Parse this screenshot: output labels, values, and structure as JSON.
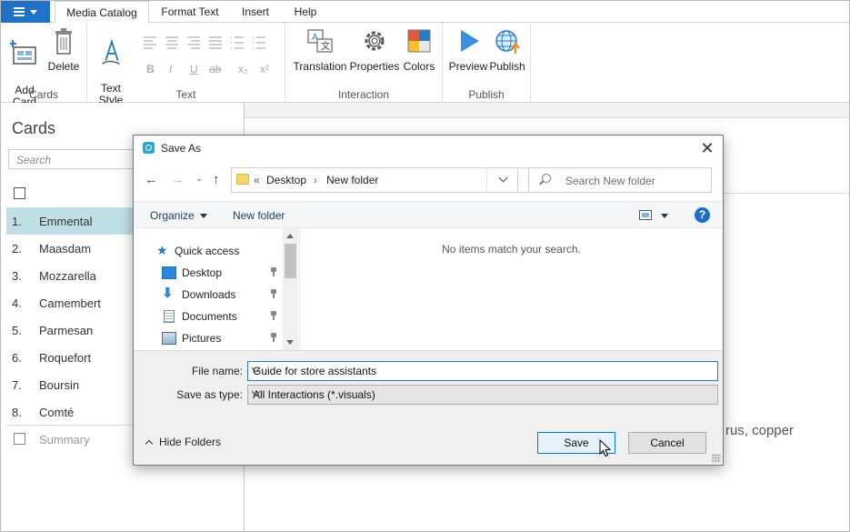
{
  "ribbon": {
    "tabs": [
      {
        "label": "Media Catalog",
        "active": true
      },
      {
        "label": "Format Text",
        "active": false
      },
      {
        "label": "Insert",
        "active": false
      },
      {
        "label": "Help",
        "active": false
      }
    ],
    "groups": {
      "cards": {
        "label": "Cards",
        "add_label": "Add\nCard",
        "delete_label": "Delete"
      },
      "text": {
        "label": "Text",
        "text_style_label": "Text\nStyle"
      },
      "interaction": {
        "label": "Interaction",
        "translation_label": "Translation",
        "properties_label": "Properties",
        "colors_label": "Colors"
      },
      "publish": {
        "label": "Publish",
        "preview_label": "Preview",
        "publish_label": "Publish"
      }
    },
    "format_glyphs": {
      "bold": "B",
      "italic": "I",
      "underline": "U",
      "strike": "ab",
      "subscript": "x₂",
      "superscript": "x²"
    }
  },
  "left_panel": {
    "title": "Cards",
    "search_placeholder": "Search",
    "cards": [
      {
        "num": "1.",
        "name": "Emmental",
        "selected": true
      },
      {
        "num": "2.",
        "name": "Maasdam",
        "selected": false
      },
      {
        "num": "3.",
        "name": "Mozzarella",
        "selected": false
      },
      {
        "num": "4.",
        "name": "Camembert",
        "selected": false
      },
      {
        "num": "5.",
        "name": "Parmesan",
        "selected": false
      },
      {
        "num": "6.",
        "name": "Roquefort",
        "selected": false
      },
      {
        "num": "7.",
        "name": "Boursin",
        "selected": false
      },
      {
        "num": "8.",
        "name": "Comté",
        "selected": false
      }
    ],
    "summary_label": "Summary"
  },
  "main": {
    "background_text": "rus, copper"
  },
  "dialog": {
    "title": "Save As",
    "address": {
      "overflow": "«",
      "segment1": "Desktop",
      "segment2": "New folder"
    },
    "search_placeholder": "Search New folder",
    "organize_label": "Organize",
    "new_folder_label": "New folder",
    "help_glyph": "?",
    "nav": {
      "quick_access": "Quick access",
      "items": [
        "Desktop",
        "Downloads",
        "Documents",
        "Pictures"
      ]
    },
    "empty_message": "No items match your search.",
    "file_name_label": "File name:",
    "file_name_value": "Guide for store assistants",
    "save_type_label": "Save as type:",
    "save_type_value": "All Interactions (*.visuals)",
    "hide_folders_label": "Hide Folders",
    "save_label": "Save",
    "cancel_label": "Cancel"
  },
  "colors": {
    "accent": "#1f72c6",
    "selected_row": "#bfe0e6",
    "save_button_border": "#0078d7"
  }
}
